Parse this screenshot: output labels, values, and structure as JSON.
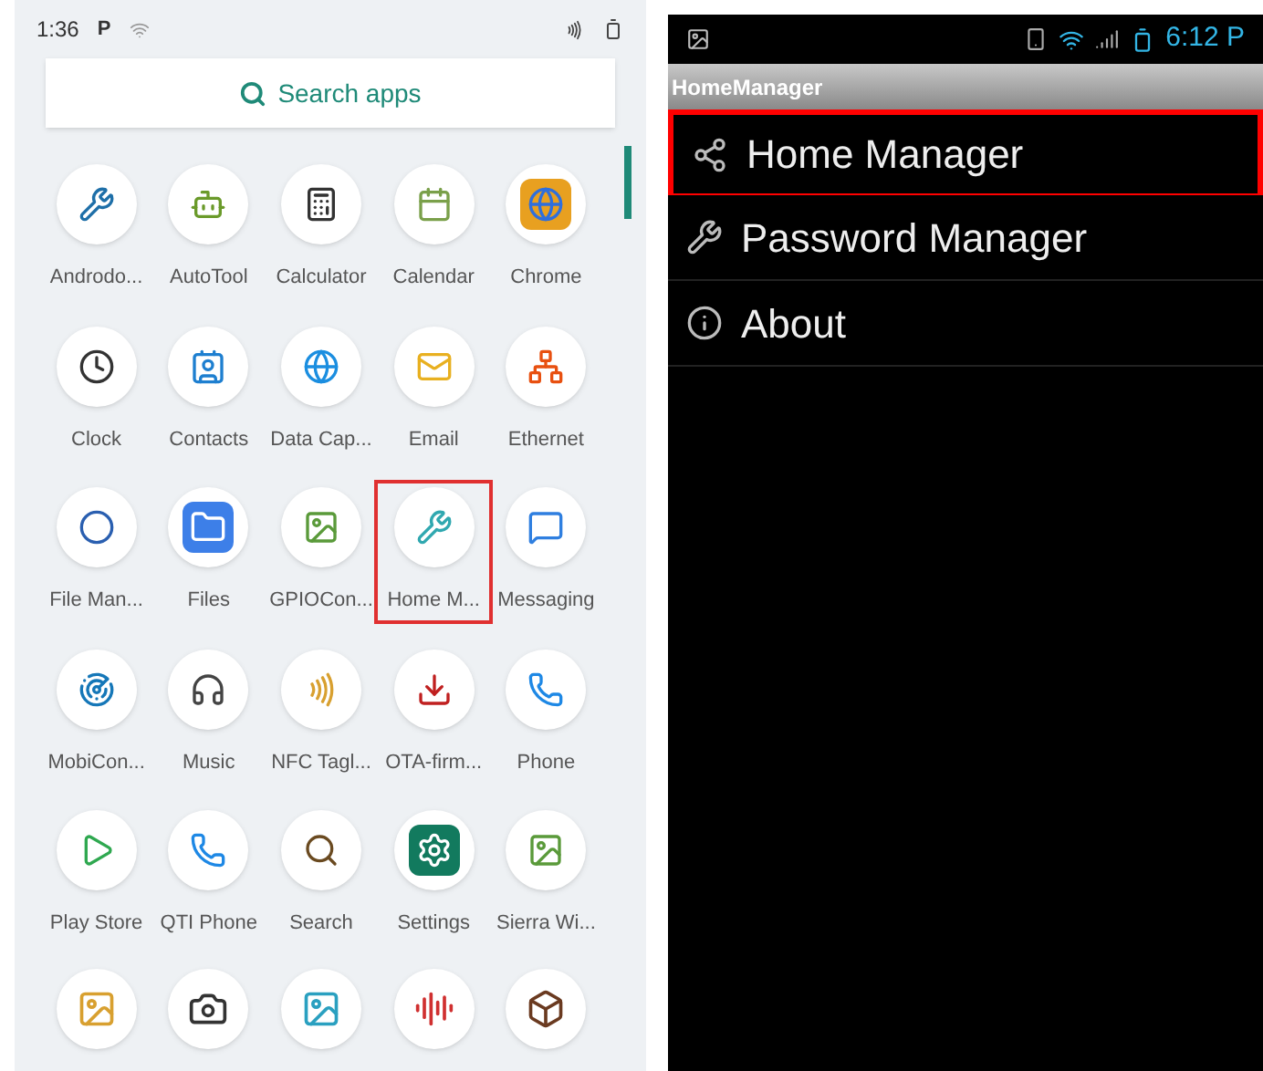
{
  "launcher": {
    "status_bar": {
      "time": "1:36",
      "notification": "P"
    },
    "search": {
      "placeholder": "Search apps"
    },
    "apps": [
      {
        "label": "Androdo...",
        "highlighted": false
      },
      {
        "label": "AutoTool",
        "highlighted": false
      },
      {
        "label": "Calculator",
        "highlighted": false
      },
      {
        "label": "Calendar",
        "highlighted": false
      },
      {
        "label": "Chrome",
        "highlighted": false
      },
      {
        "label": "Clock",
        "highlighted": false
      },
      {
        "label": "Contacts",
        "highlighted": false
      },
      {
        "label": "Data Cap...",
        "highlighted": false
      },
      {
        "label": "Email",
        "highlighted": false
      },
      {
        "label": "Ethernet",
        "highlighted": false
      },
      {
        "label": "File Man...",
        "highlighted": false
      },
      {
        "label": "Files",
        "highlighted": false
      },
      {
        "label": "GPIOCon...",
        "highlighted": false
      },
      {
        "label": "Home M...",
        "highlighted": true
      },
      {
        "label": "Messaging",
        "highlighted": false
      },
      {
        "label": "MobiCon...",
        "highlighted": false
      },
      {
        "label": "Music",
        "highlighted": false
      },
      {
        "label": "NFC Tagl...",
        "highlighted": false
      },
      {
        "label": "OTA-firm...",
        "highlighted": false
      },
      {
        "label": "Phone",
        "highlighted": false
      },
      {
        "label": "Play Store",
        "highlighted": false
      },
      {
        "label": "QTI Phone",
        "highlighted": false
      },
      {
        "label": "Search",
        "highlighted": false
      },
      {
        "label": "Settings",
        "highlighted": false
      },
      {
        "label": "Sierra Wi...",
        "highlighted": false
      }
    ]
  },
  "home_manager": {
    "status_bar": {
      "time": "6:12 P"
    },
    "title": "HomeManager",
    "menu": [
      {
        "label": "Home Manager",
        "selected": true
      },
      {
        "label": "Password Manager",
        "selected": false
      },
      {
        "label": "About",
        "selected": false
      }
    ]
  }
}
